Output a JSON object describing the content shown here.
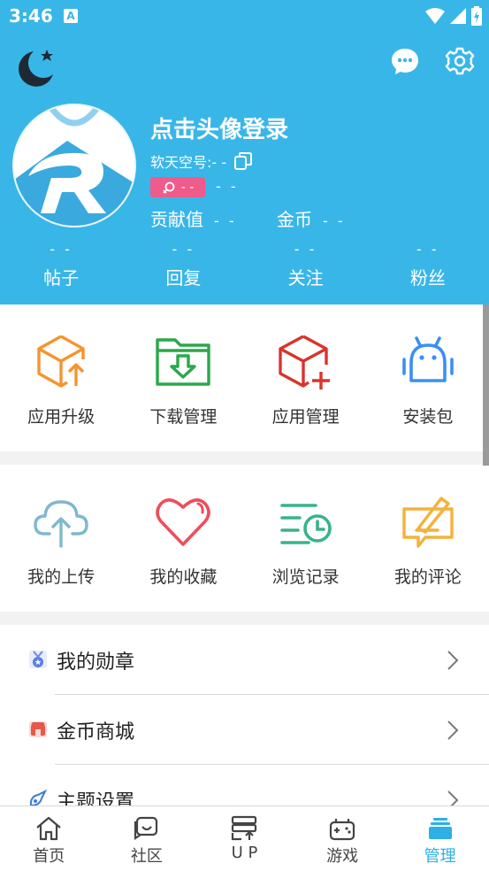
{
  "status": {
    "time": "3:46",
    "a_label": "A"
  },
  "header": {
    "login_title": "点击头像登录",
    "uid_label": "软天空号:- -",
    "badge_text": "- -",
    "badge_value": "- -",
    "contribution_label": "贡献值",
    "contribution_value": "- -",
    "coin_label": "金币",
    "coin_value": "- -"
  },
  "counts": [
    {
      "value": "- -",
      "label": "帖子"
    },
    {
      "value": "- -",
      "label": "回复"
    },
    {
      "value": "- -",
      "label": "关注"
    },
    {
      "value": "- -",
      "label": "粉丝"
    }
  ],
  "grid1": [
    {
      "label": "应用升级",
      "icon": "box-upgrade-icon",
      "color": "#f5942f"
    },
    {
      "label": "下载管理",
      "icon": "folder-download-icon",
      "color": "#2aa84a"
    },
    {
      "label": "应用管理",
      "icon": "box-add-icon",
      "color": "#d9342b"
    },
    {
      "label": "安装包",
      "icon": "android-icon",
      "color": "#3b8ff3"
    }
  ],
  "grid2": [
    {
      "label": "我的上传",
      "icon": "cloud-upload-icon",
      "color": "#7fb8cf"
    },
    {
      "label": "我的收藏",
      "icon": "heart-icon",
      "color": "#ef4d5c"
    },
    {
      "label": "浏览记录",
      "icon": "history-icon",
      "color": "#37b38a"
    },
    {
      "label": "我的评论",
      "icon": "comment-icon",
      "color": "#f3b23a"
    }
  ],
  "list": [
    {
      "label": "我的勋章",
      "icon": "medal-icon"
    },
    {
      "label": "金币商城",
      "icon": "shop-icon"
    },
    {
      "label": "主题设置",
      "icon": "theme-icon"
    }
  ],
  "nav": [
    {
      "label": "首页",
      "icon": "home-icon"
    },
    {
      "label": "社区",
      "icon": "community-icon"
    },
    {
      "label": "U P",
      "icon": "upload-server-icon"
    },
    {
      "label": "游戏",
      "icon": "gamepad-icon"
    },
    {
      "label": "管理",
      "icon": "manage-icon",
      "active": true
    }
  ],
  "colors": {
    "header_bg": "#39b6e8",
    "accent": "#2cb0e6",
    "badge": "#ef5b8a"
  }
}
